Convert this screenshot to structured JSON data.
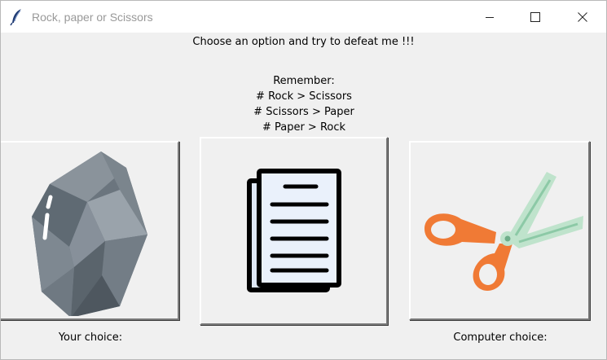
{
  "window": {
    "title": "Rock, paper or Scissors",
    "icon": "feather-icon",
    "controls": [
      "minimize-icon",
      "maximize-icon",
      "close-icon"
    ]
  },
  "main": {
    "headline": "Choose an option and try to defeat me !!!",
    "remember_lines": [
      "Remember:",
      "# Rock > Scissors",
      "# Scissors > Paper",
      "# Paper > Rock"
    ],
    "buttons": [
      {
        "name": "rock",
        "icon": "rock-icon"
      },
      {
        "name": "paper",
        "icon": "paper-icon"
      },
      {
        "name": "scissors",
        "icon": "scissors-icon"
      }
    ],
    "your_choice_label": "Your choice:",
    "computer_choice_label": "Computer choice:"
  },
  "colors": {
    "background": "#f0f0f0",
    "scissors_handle": "#f07a35",
    "scissors_blade": "#bfe3cc",
    "rock_dark": "#5f6a73",
    "rock_light": "#9aa3ab",
    "paper_fill": "#eaf1fb"
  }
}
